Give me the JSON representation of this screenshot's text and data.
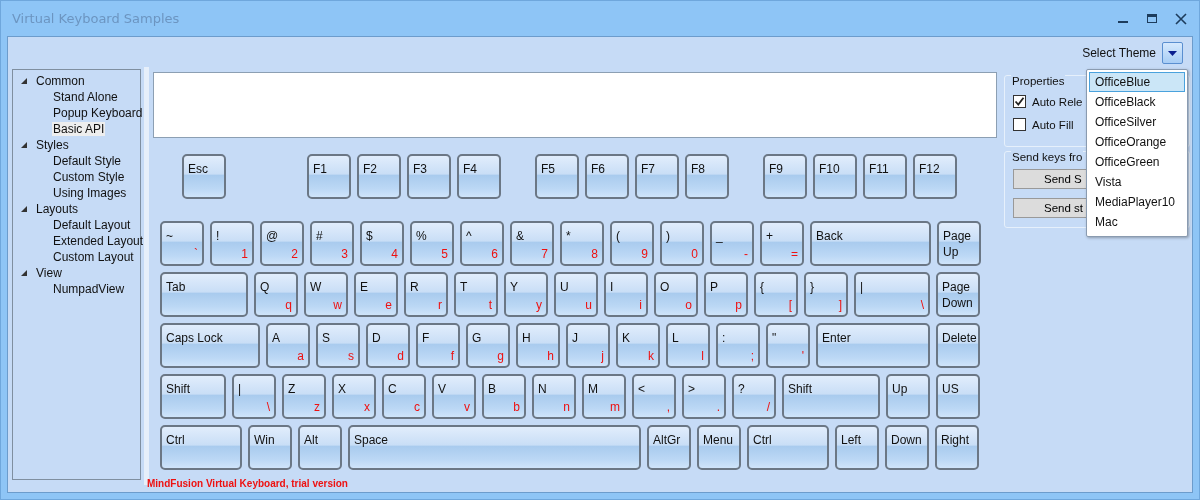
{
  "window": {
    "title": "Virtual Keyboard Samples"
  },
  "tree": [
    {
      "label": "Common",
      "expanded": true,
      "children": [
        {
          "label": "Stand Alone",
          "selected": false
        },
        {
          "label": "Popup Keyboard",
          "selected": false
        },
        {
          "label": "Basic API",
          "selected": true
        }
      ]
    },
    {
      "label": "Styles",
      "expanded": true,
      "children": [
        {
          "label": "Default Style",
          "selected": false
        },
        {
          "label": "Custom Style",
          "selected": false
        },
        {
          "label": "Using Images",
          "selected": false
        }
      ]
    },
    {
      "label": "Layouts",
      "expanded": true,
      "children": [
        {
          "label": "Default Layout",
          "selected": false
        },
        {
          "label": "Extended Layout",
          "selected": false
        },
        {
          "label": "Custom Layout",
          "selected": false
        }
      ]
    },
    {
      "label": "View",
      "expanded": true,
      "children": [
        {
          "label": "NumpadView",
          "selected": false
        }
      ]
    }
  ],
  "theme_selector": {
    "label": "Select Theme",
    "expanded": true,
    "options": [
      {
        "label": "OfficeBlue",
        "selected": true
      },
      {
        "label": "OfficeBlack",
        "selected": false
      },
      {
        "label": "OfficeSilver",
        "selected": false
      },
      {
        "label": "OfficeOrange",
        "selected": false
      },
      {
        "label": "OfficeGreen",
        "selected": false
      },
      {
        "label": "Vista",
        "selected": false
      },
      {
        "label": "MediaPlayer10",
        "selected": false
      },
      {
        "label": "Mac",
        "selected": false
      }
    ]
  },
  "keyboard": {
    "function_row": [
      [
        {
          "label": "Esc"
        }
      ],
      [
        {
          "label": "F1"
        },
        {
          "label": "F2"
        },
        {
          "label": "F3"
        },
        {
          "label": "F4"
        }
      ],
      [
        {
          "label": "F5"
        },
        {
          "label": "F6"
        },
        {
          "label": "F7"
        },
        {
          "label": "F8"
        }
      ],
      [
        {
          "label": "F9"
        },
        {
          "label": "F10"
        },
        {
          "label": "F11"
        },
        {
          "label": "F12"
        }
      ]
    ],
    "rows": [
      {
        "keys": [
          {
            "kind": "key",
            "label": "~",
            "char": "`"
          },
          {
            "kind": "key",
            "label": "!",
            "char": "1"
          },
          {
            "kind": "key",
            "label": "@",
            "char": "2"
          },
          {
            "kind": "key",
            "label": "#",
            "char": "3"
          },
          {
            "kind": "key",
            "label": "$",
            "char": "4"
          },
          {
            "kind": "key",
            "label": "%",
            "char": "5"
          },
          {
            "kind": "key",
            "label": "^",
            "char": "6"
          },
          {
            "kind": "key",
            "label": "&",
            "char": "7"
          },
          {
            "kind": "key",
            "label": "*",
            "char": "8"
          },
          {
            "kind": "key",
            "label": "(",
            "char": "9"
          },
          {
            "kind": "key",
            "label": ")",
            "char": "0"
          },
          {
            "kind": "key",
            "label": "_",
            "char": "-"
          },
          {
            "kind": "key",
            "label": "+",
            "char": "="
          },
          {
            "kind": "back",
            "label": "Back"
          },
          {
            "kind": "key",
            "label": "Page Up"
          }
        ]
      },
      {
        "keys": [
          {
            "kind": "tab",
            "label": "Tab"
          },
          {
            "kind": "key",
            "label": "Q",
            "char": "q"
          },
          {
            "kind": "key",
            "label": "W",
            "char": "w"
          },
          {
            "kind": "key",
            "label": "E",
            "char": "e"
          },
          {
            "kind": "key",
            "label": "R",
            "char": "r"
          },
          {
            "kind": "key",
            "label": "T",
            "char": "t"
          },
          {
            "kind": "key",
            "label": "Y",
            "char": "y"
          },
          {
            "kind": "key",
            "label": "U",
            "char": "u"
          },
          {
            "kind": "key",
            "label": "I",
            "char": "i"
          },
          {
            "kind": "key",
            "label": "O",
            "char": "o"
          },
          {
            "kind": "key",
            "label": "P",
            "char": "p"
          },
          {
            "kind": "key",
            "label": "{",
            "char": "["
          },
          {
            "kind": "key",
            "label": "}",
            "char": "]"
          },
          {
            "kind": "pipe",
            "label": "|",
            "char": "\\"
          },
          {
            "kind": "key",
            "label": "Page Down"
          }
        ]
      },
      {
        "keys": [
          {
            "kind": "caps",
            "label": "Caps Lock"
          },
          {
            "kind": "key",
            "label": "A",
            "char": "a"
          },
          {
            "kind": "key",
            "label": "S",
            "char": "s"
          },
          {
            "kind": "key",
            "label": "D",
            "char": "d"
          },
          {
            "kind": "key",
            "label": "F",
            "char": "f"
          },
          {
            "kind": "key",
            "label": "G",
            "char": "g"
          },
          {
            "kind": "key",
            "label": "H",
            "char": "h"
          },
          {
            "kind": "key",
            "label": "J",
            "char": "j"
          },
          {
            "kind": "key",
            "label": "K",
            "char": "k"
          },
          {
            "kind": "key",
            "label": "L",
            "char": "l"
          },
          {
            "kind": "key",
            "label": ":",
            "char": ";"
          },
          {
            "kind": "key",
            "label": "\"",
            "char": "'"
          },
          {
            "kind": "enter",
            "label": "Enter"
          },
          {
            "kind": "key",
            "label": "Delete"
          }
        ]
      },
      {
        "keys": [
          {
            "kind": "lshift",
            "label": "Shift"
          },
          {
            "kind": "key",
            "label": "|",
            "char": "\\"
          },
          {
            "kind": "key",
            "label": "Z",
            "char": "z"
          },
          {
            "kind": "key",
            "label": "X",
            "char": "x"
          },
          {
            "kind": "key",
            "label": "C",
            "char": "c"
          },
          {
            "kind": "key",
            "label": "V",
            "char": "v"
          },
          {
            "kind": "key",
            "label": "B",
            "char": "b"
          },
          {
            "kind": "key",
            "label": "N",
            "char": "n"
          },
          {
            "kind": "key",
            "label": "M",
            "char": "m"
          },
          {
            "kind": "key",
            "label": "<",
            "char": ","
          },
          {
            "kind": "key",
            "label": ">",
            "char": "."
          },
          {
            "kind": "key",
            "label": "?",
            "char": "/"
          },
          {
            "kind": "rshift",
            "label": "Shift"
          },
          {
            "kind": "key",
            "label": "Up"
          },
          {
            "kind": "key",
            "label": "US"
          }
        ]
      },
      {
        "keys": [
          {
            "kind": "ctrl",
            "label": "Ctrl"
          },
          {
            "kind": "key",
            "label": "Win"
          },
          {
            "kind": "key",
            "label": "Alt"
          },
          {
            "kind": "space",
            "label": "Space"
          },
          {
            "kind": "key",
            "label": "AltGr"
          },
          {
            "kind": "key",
            "label": "Menu"
          },
          {
            "kind": "ctrl",
            "label": "Ctrl"
          },
          {
            "kind": "key",
            "label": "Left"
          },
          {
            "kind": "key",
            "label": "Down"
          },
          {
            "kind": "key",
            "label": "Right"
          }
        ]
      }
    ]
  },
  "properties": {
    "title": "Properties",
    "checkboxes": [
      {
        "label": "Auto Rele",
        "checked": true
      },
      {
        "label": "Auto Fill",
        "checked": false
      }
    ]
  },
  "send_keys": {
    "title": "Send keys fro",
    "buttons": [
      "Send S",
      "Send st"
    ]
  },
  "footer": "MindFusion Virtual Keyboard, trial version"
}
